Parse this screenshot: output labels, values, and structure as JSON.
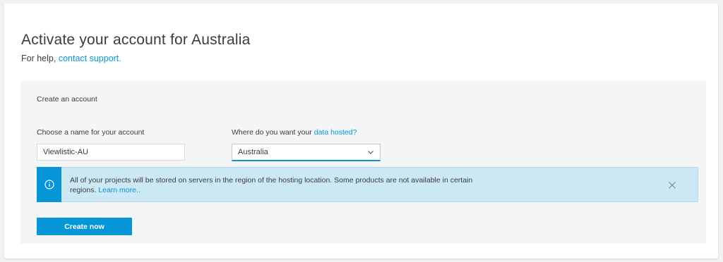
{
  "page": {
    "title": "Activate your account for Australia",
    "help_prefix": "For help, ",
    "help_link": "contact support."
  },
  "form": {
    "section_title": "Create an account",
    "name_label": "Choose a name for your account",
    "name_value": "Viewlistic-AU",
    "host_label_prefix": "Where do you want your ",
    "host_label_link": "data hosted?",
    "host_value": "Australia"
  },
  "banner": {
    "text": "All of your projects will be stored on servers in the region of the hosting location. Some products are not available in certain regions. ",
    "link": "Learn more..",
    "icon": "info-icon",
    "close_icon": "close-icon"
  },
  "actions": {
    "create_label": "Create now"
  },
  "colors": {
    "accent": "#0696d7",
    "banner_bg": "#cde8f5",
    "panel_bg": "#f4f5f7"
  }
}
